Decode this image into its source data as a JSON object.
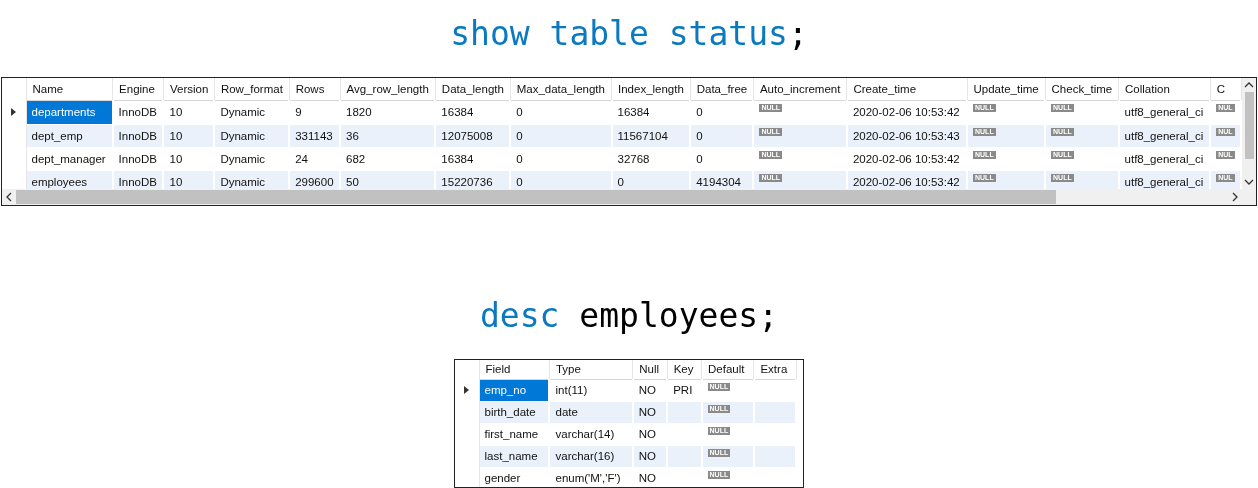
{
  "status_query": {
    "parts": [
      {
        "kind": "keyword",
        "text": "show table status"
      },
      {
        "kind": "plain",
        "text": ";"
      }
    ]
  },
  "status_table": {
    "columns": [
      "Name",
      "Engine",
      "Version",
      "Row_format",
      "Rows",
      "Avg_row_length",
      "Data_length",
      "Max_data_length",
      "Index_length",
      "Data_free",
      "Auto_increment",
      "Create_time",
      "Update_time",
      "Check_time",
      "Collation",
      "C"
    ],
    "rows": [
      {
        "current": true,
        "cells": [
          {
            "text": "departments",
            "selected": true
          },
          "InnoDB",
          "10",
          "Dynamic",
          "9",
          "1820",
          "16384",
          "0",
          "16384",
          "0",
          {
            "kind": "null",
            "text": "NULL"
          },
          "2020-02-06 10:53:42",
          {
            "kind": "null",
            "text": "NULL"
          },
          {
            "kind": "null",
            "text": "NULL"
          },
          "utf8_general_ci",
          {
            "kind": "null",
            "text": "NUL"
          }
        ]
      },
      {
        "current": false,
        "cells": [
          {
            "text": "dept_emp",
            "selected": false
          },
          "InnoDB",
          "10",
          "Dynamic",
          "331143",
          "36",
          "12075008",
          "0",
          "11567104",
          "0",
          {
            "kind": "null",
            "text": "NULL"
          },
          "2020-02-06 10:53:43",
          {
            "kind": "null",
            "text": "NULL"
          },
          {
            "kind": "null",
            "text": "NULL"
          },
          "utf8_general_ci",
          {
            "kind": "null",
            "text": "NUL"
          }
        ]
      },
      {
        "current": false,
        "cells": [
          {
            "text": "dept_manager",
            "selected": false
          },
          "InnoDB",
          "10",
          "Dynamic",
          "24",
          "682",
          "16384",
          "0",
          "32768",
          "0",
          {
            "kind": "null",
            "text": "NULL"
          },
          "2020-02-06 10:53:42",
          {
            "kind": "null",
            "text": "NULL"
          },
          {
            "kind": "null",
            "text": "NULL"
          },
          "utf8_general_ci",
          {
            "kind": "null",
            "text": "NUL"
          }
        ]
      },
      {
        "current": false,
        "cells": [
          {
            "text": "employees",
            "selected": false
          },
          "InnoDB",
          "10",
          "Dynamic",
          "299600",
          "50",
          "15220736",
          "0",
          "0",
          "4194304",
          {
            "kind": "null",
            "text": "NULL"
          },
          "2020-02-06 10:53:42",
          {
            "kind": "null",
            "text": "NULL"
          },
          {
            "kind": "null",
            "text": "NULL"
          },
          "utf8_general_ci",
          {
            "kind": "null",
            "text": "NUL"
          }
        ]
      }
    ]
  },
  "desc_query": {
    "parts": [
      {
        "kind": "keyword",
        "text": "desc"
      },
      {
        "kind": "plain",
        "text": " employees;"
      }
    ]
  },
  "desc_table": {
    "columns": [
      "Field",
      "Type",
      "Null",
      "Key",
      "Default",
      "Extra"
    ],
    "rows": [
      {
        "current": true,
        "cells": [
          {
            "text": "emp_no",
            "selected": true
          },
          "int(11)",
          "NO",
          "PRI",
          {
            "kind": "null",
            "text": "NULL"
          },
          ""
        ]
      },
      {
        "current": false,
        "cells": [
          {
            "text": "birth_date",
            "selected": false
          },
          "date",
          "NO",
          "",
          {
            "kind": "null",
            "text": "NULL"
          },
          ""
        ]
      },
      {
        "current": false,
        "cells": [
          {
            "text": "first_name",
            "selected": false
          },
          "varchar(14)",
          "NO",
          "",
          {
            "kind": "null",
            "text": "NULL"
          },
          ""
        ]
      },
      {
        "current": false,
        "cells": [
          {
            "text": "last_name",
            "selected": false
          },
          "varchar(16)",
          "NO",
          "",
          {
            "kind": "null",
            "text": "NULL"
          },
          ""
        ]
      },
      {
        "current": false,
        "cells": [
          {
            "text": "gender",
            "selected": false
          },
          "enum('M','F')",
          "NO",
          "",
          {
            "kind": "null",
            "text": "NULL"
          },
          ""
        ]
      }
    ]
  }
}
